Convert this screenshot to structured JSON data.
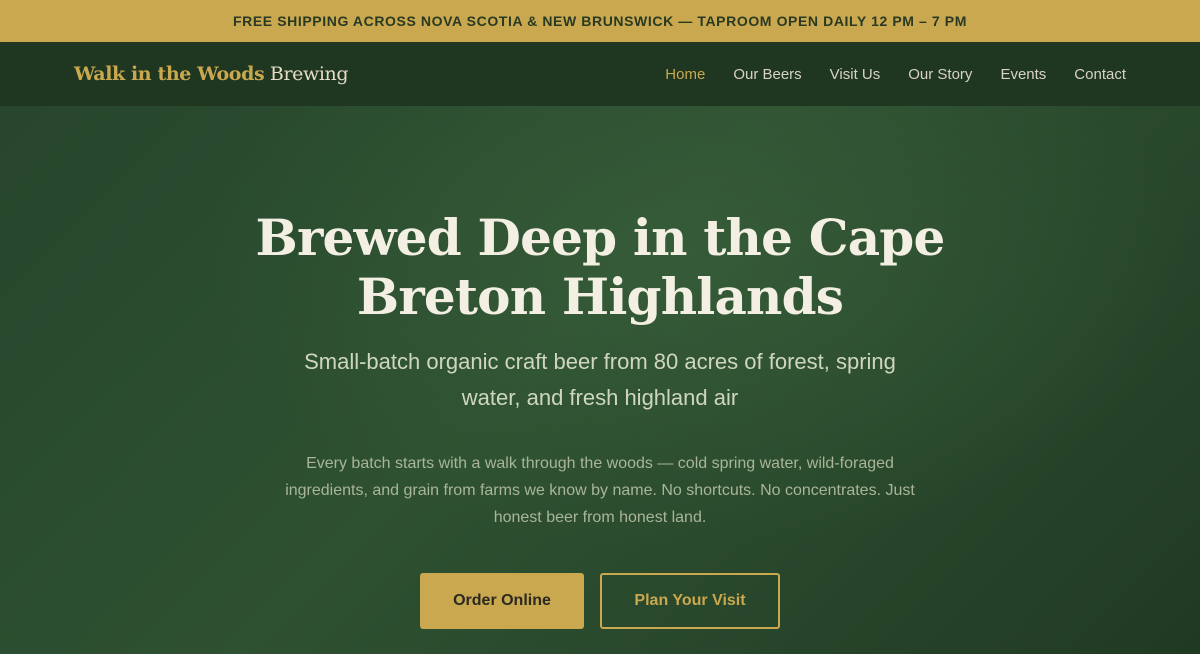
{
  "announcement": "FREE SHIPPING ACROSS NOVA SCOTIA & NEW BRUNSWICK — TAPROOM OPEN DAILY 12 PM – 7 PM",
  "logo": {
    "primary": "Walk in the Woods",
    "secondary": " Brewing"
  },
  "nav": {
    "items": [
      {
        "label": "Home",
        "active": true
      },
      {
        "label": "Our Beers",
        "active": false
      },
      {
        "label": "Visit Us",
        "active": false
      },
      {
        "label": "Our Story",
        "active": false
      },
      {
        "label": "Events",
        "active": false
      },
      {
        "label": "Contact",
        "active": false
      }
    ]
  },
  "hero": {
    "title": "Brewed Deep in the Cape Breton Highlands",
    "subtitle": "Small-batch organic craft beer from 80 acres of forest, spring water, and fresh highland air",
    "body": "Every batch starts with a walk through the woods — cold spring water, wild-foraged ingredients, and grain from farms we know by name. No shortcuts. No concentrates. Just honest beer from honest land.",
    "primary_cta": "Order Online",
    "secondary_cta": "Plan Your Visit"
  },
  "colors": {
    "accent": "#c9a84f",
    "nav_bg": "#1f3620",
    "hero_bg": "#2e5131",
    "text_light": "#f4efe3"
  }
}
